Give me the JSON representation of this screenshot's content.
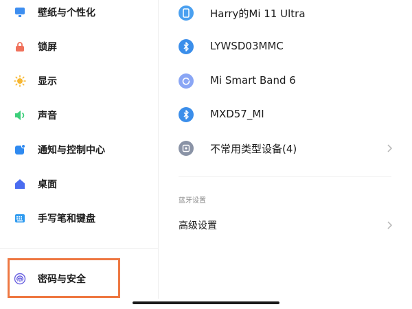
{
  "sidebar": {
    "items": [
      {
        "label": "壁纸与个性化",
        "icon": "wallpaper-icon",
        "color": "#3d8ef0"
      },
      {
        "label": "锁屏",
        "icon": "lock-icon",
        "color": "#f0705a"
      },
      {
        "label": "显示",
        "icon": "sun-icon",
        "color": "#f7b731"
      },
      {
        "label": "声音",
        "icon": "speaker-icon",
        "color": "#3ccf7a"
      },
      {
        "label": "通知与控制中心",
        "icon": "notification-icon",
        "color": "#2f8af0"
      },
      {
        "label": "桌面",
        "icon": "home-icon",
        "color": "#4a6cf0"
      },
      {
        "label": "手写笔和键盘",
        "icon": "keyboard-icon",
        "color": "#2f9bf0"
      }
    ],
    "security": {
      "label": "密码与安全",
      "icon": "fingerprint-icon",
      "color": "#6a62e0"
    }
  },
  "devices": [
    {
      "label": "Harry的Mi 11 Ultra",
      "icon": "phone-icon",
      "color": "#4aa0f0"
    },
    {
      "label": "LYWSD03MMC",
      "icon": "bluetooth-icon",
      "color": "#3b8eea"
    },
    {
      "label": "Mi Smart Band 6",
      "icon": "band-icon",
      "color": "#8aa6f5"
    },
    {
      "label": "MXD57_MI",
      "icon": "bluetooth-icon",
      "color": "#3b8eea"
    },
    {
      "label": "不常用类型设备(4)",
      "icon": "device-icon",
      "color": "#8a93a6"
    }
  ],
  "bluetooth_settings": {
    "section_title": "蓝牙设置",
    "advanced_label": "高级设置"
  },
  "highlight_color": "#ee7842"
}
